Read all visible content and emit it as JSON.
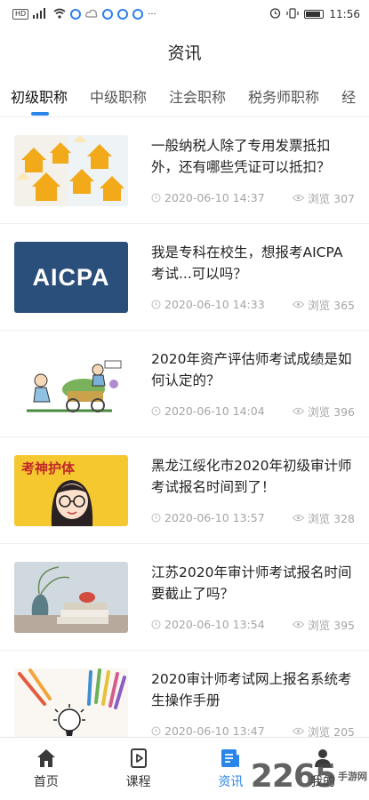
{
  "status_bar": {
    "left_chip": "HD",
    "time": "11:56",
    "more": "···"
  },
  "header": {
    "title": "资讯"
  },
  "tabs": [
    {
      "label": "初级职称",
      "active": true
    },
    {
      "label": "中级职称",
      "active": false
    },
    {
      "label": "注会职称",
      "active": false
    },
    {
      "label": "税务师职称",
      "active": false
    },
    {
      "label": "经",
      "active": false
    }
  ],
  "articles": [
    {
      "title": "一般纳税人除了专用发票抵扣外，还有哪些凭证可以抵扣？",
      "date": "2020-06-10 14:37",
      "views": "浏览 307",
      "thumb": "houses"
    },
    {
      "title": "我是专科在校生，想报考AICPA考试...可以吗？",
      "date": "2020-06-10 14:33",
      "views": "浏览 365",
      "thumb": "aicpa",
      "thumb_text": "AICPA"
    },
    {
      "title": "2020年资产评估师考试成绩是如何认定的？",
      "date": "2020-06-10 14:04",
      "views": "浏览 396",
      "thumb": "cart"
    },
    {
      "title": "黑龙江绥化市2020年初级审计师考试报名时间到了！",
      "date": "2020-06-10 13:57",
      "views": "浏览 328",
      "thumb": "cartoon-girl",
      "thumb_text": "考神护体"
    },
    {
      "title": "江苏2020年审计师考试报名时间要截止了吗？",
      "date": "2020-06-10 13:54",
      "views": "浏览 395",
      "thumb": "books"
    },
    {
      "title": "2020审计师考试网上报名系统考生操作手册",
      "date": "2020-06-10 13:47",
      "views": "浏览 205",
      "thumb": "pencils"
    }
  ],
  "bottom_nav": [
    {
      "label": "首页",
      "icon": "home-icon",
      "active": false
    },
    {
      "label": "课程",
      "icon": "course-icon",
      "active": false
    },
    {
      "label": "资讯",
      "icon": "news-icon",
      "active": true
    },
    {
      "label": "我的",
      "icon": "user-icon",
      "active": false
    }
  ],
  "watermark": {
    "big": "2265",
    "small": "手游网"
  },
  "colors": {
    "accent": "#2b86ea",
    "meta_text": "#a5a5a5",
    "aicpa_bg": "#2a4f7a"
  }
}
